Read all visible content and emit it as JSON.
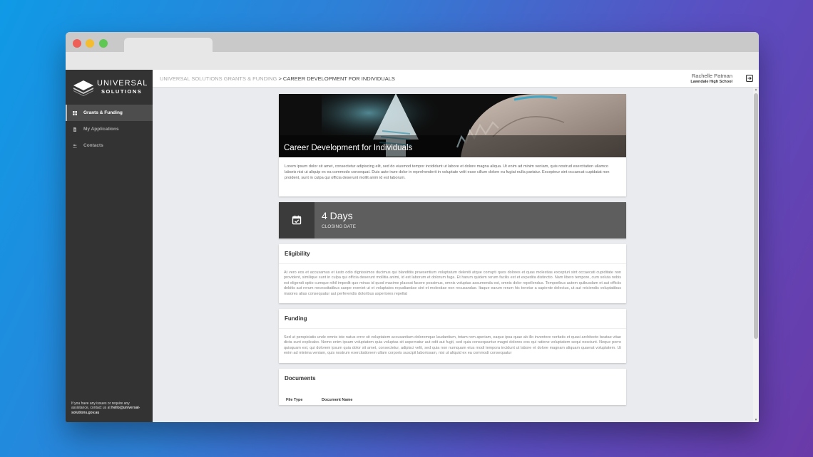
{
  "sidebar": {
    "logo": {
      "line1": "UNIVERSAL",
      "line2": "SOLUTIONS"
    },
    "items": [
      {
        "label": "Grants & Funding",
        "icon": "grid-icon",
        "active": true
      },
      {
        "label": "My Applications",
        "icon": "document-icon",
        "active": false
      },
      {
        "label": "Contacts",
        "icon": "people-icon",
        "active": false
      }
    ],
    "footer_text": "If you have any issues or require any assistance, contact us at",
    "footer_email": "hello@universal-solutions.gov.au"
  },
  "header": {
    "breadcrumb_parent": "UNIVERSAL SOLUTIONS GRANTS & FUNDING",
    "breadcrumb_sep": ">",
    "breadcrumb_current": "CAREER DEVELOPMENT FOR INDIVIDUALS",
    "user_name": "Rachelle Patman",
    "user_school": "Lawndale High School"
  },
  "grant": {
    "title": "Career Development for Individuals",
    "description": "Lorem ipsum dolor sit amet, consectetur adipiscing elit, sed do eiusmod tempor incididunt ut labore et dolore magna aliqua. Ut enim ad minim veniam, quis nostrud exercitation ullamco laboris nisi ut aliquip ex ea commodo consequat. Duis aute irure dolor in reprehenderit in voluptate velit esse cillum dolore eu fugiat nulla pariatur. Excepteur sint occaecat cupidatat non proident, sunt in culpa qui officia deserunt mollit anim id est laborum."
  },
  "closing": {
    "days": "4 Days",
    "label": "CLOSING DATE"
  },
  "eligibility": {
    "heading": "Eligibility",
    "body": "At vero eos et accusamus et iusto odio dignissimos ducimus qui blanditiis praesentium voluptatum deleniti atque corrupti quos dolores et quas molestias excepturi sint occaecati cupiditate non provident, similique sunt in culpa qui officia deserunt mollitia animi, id est laborum et dolorum fuga. Et harum quidem rerum facilis est et expedita distinctio. Nam libero tempore, cum soluta nobis est eligendi optio cumque nihil impedit quo minus id quod maxime placeat facere possimus, omnis voluptas assumenda est, omnis dolor repellendus. Temporibus autem quibusdam et aut officiis debitis aut rerum necessitatibus saepe eveniet ut et voluptates repudiandae sint et molestiae non recusandae. Itaque earum rerum hic tenetur a sapiente delectus, ut aut reiciendis voluptatibus maiores alias consequatur aut perferendis doloribus asperiores repellat"
  },
  "funding": {
    "heading": "Funding",
    "body": "Sed ut perspiciatis unde omnis iste natus error sit voluptatem accusantium doloremque laudantium, totam rem aperiam, eaque ipsa quae ab illo inventore veritatis et quasi architecto beatae vitae dicta sunt explicabo. Nemo enim ipsam voluptatem quia voluptas sit aspernatur aut odit aut fugit, sed quia consequuntur magni dolores eos qui ratione voluptatem sequi nesciunt. Neque porro quisquam est, qui dolorem ipsum quia dolor sit amet, consectetur, adipisci velit, sed quia non numquam eius modi tempora incidunt ut labore et dolore magnam aliquam quaerat voluptatem. Ut enim ad minima veniam, quis nostrum exercitationem ullam corporis suscipit laboriosam, nisi ut aliquid ex ea commodi consequatur"
  },
  "documents": {
    "heading": "Documents",
    "columns": [
      "File Type",
      "Document Name"
    ]
  },
  "colors": {
    "sidebar_bg": "#333333",
    "sidebar_active": "#4d4d4d",
    "closing_bg": "#5e5e5e",
    "closing_icon_bg": "#3b3b3b",
    "page_bg": "#e9ebee"
  }
}
